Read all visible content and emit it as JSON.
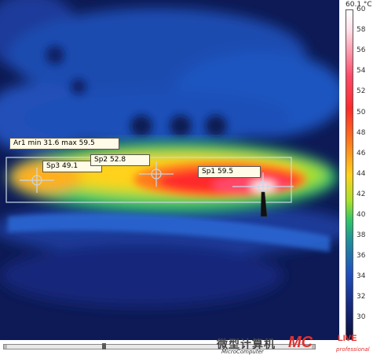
{
  "scale": {
    "max_label": "60.1 °C",
    "ticks": [
      "60",
      "58",
      "56",
      "54",
      "52",
      "50",
      "48",
      "46",
      "44",
      "42",
      "40",
      "38",
      "36",
      "34",
      "32",
      "30"
    ],
    "tick_values": [
      60,
      58,
      56,
      54,
      52,
      50,
      48,
      46,
      44,
      42,
      40,
      38,
      36,
      34,
      32,
      30
    ]
  },
  "area": {
    "label": "Ar1 min 31.6 max 59.5"
  },
  "spots": [
    {
      "id": "sp1",
      "label": "Sp1 59.5"
    },
    {
      "id": "sp2",
      "label": "Sp2 52.8"
    },
    {
      "id": "sp3",
      "label": "Sp3 49.1"
    }
  ],
  "watermark": {
    "cn": "微型计算机",
    "en": "MicroComputer",
    "brand": "MC",
    "brand2": "LIVE",
    "pro": "professional"
  },
  "colors": {
    "hot": "#ff2a2a",
    "warm": "#ffd21a",
    "cool": "#1f4fbf",
    "cold": "#15287a"
  }
}
